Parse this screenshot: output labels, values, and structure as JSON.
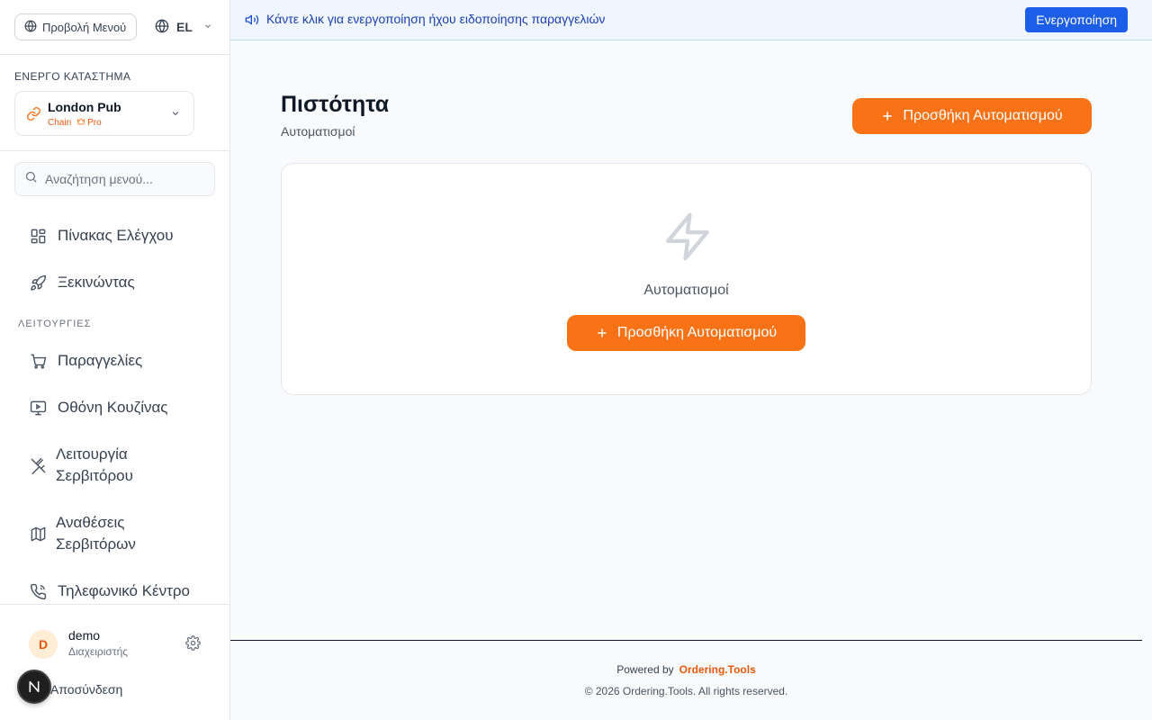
{
  "sidebar": {
    "menu_view_label": "Προβολή Μενού",
    "language": "EL",
    "active_store_label": "ΕΝΕΡΓΟ ΚΑΤΑΣΤΗΜΑ",
    "store": {
      "name": "London Pub",
      "type": "Chain",
      "plan": "Pro"
    },
    "search_placeholder": "Αναζήτηση μενού...",
    "items": [
      {
        "label": "Πίνακας Ελέγχου",
        "icon": "dashboard-icon"
      },
      {
        "label": "Ξεκινώντας",
        "icon": "rocket-icon"
      }
    ],
    "section_label": "ΛΕΙΤΟΥΡΓΙΕΣ",
    "ops_items": [
      {
        "label": "Παραγγελίες",
        "icon": "cart-icon"
      },
      {
        "label": "Οθόνη Κουζίνας",
        "icon": "monitor-icon"
      },
      {
        "label_line1": "Λειτουργία",
        "label_line2": "Σερβιτόρου",
        "icon": "utensils-crossed-icon"
      },
      {
        "label_line1": "Αναθέσεις",
        "label_line2": "Σερβιτόρων",
        "icon": "map-icon"
      },
      {
        "label": "Τηλεφωνικό Κέντρο",
        "icon": "phone-icon"
      }
    ],
    "user": {
      "initial": "D",
      "name": "demo",
      "role": "Διαχειριστής"
    },
    "logout_label": "Αποσύνδεση",
    "badge_letter": "N"
  },
  "banner": {
    "text": "Κάντε κλικ για ενεργοποίηση ήχου ειδοποίησης παραγγελιών",
    "button_label": "Ενεργοποίηση"
  },
  "main": {
    "title": "Πιστότητα",
    "subtitle": "Αυτοματισμοί",
    "add_button_label": "Προσθήκη Αυτοματισμού",
    "empty_state_text": "Αυτοματισμοί",
    "empty_add_button_label": "Προσθήκη Αυτοματισμού"
  },
  "footer": {
    "powered_by": "Powered by",
    "brand": "Ordering.Tools",
    "copyright": "© 2026 Ordering.Tools. All rights reserved."
  },
  "colors": {
    "accent": "#f97316",
    "banner_button": "#1d5ee8",
    "banner_bg": "#eff6ff"
  }
}
